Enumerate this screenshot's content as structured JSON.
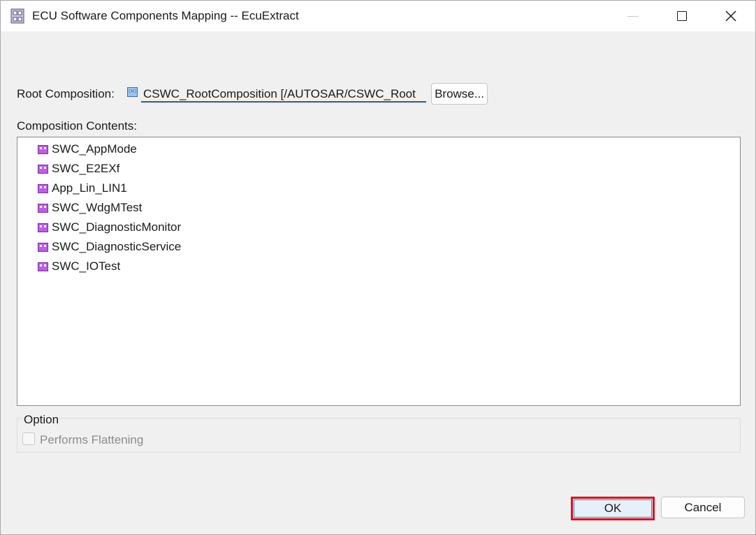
{
  "window": {
    "title": "ECU Software Components Mapping -- EcuExtract"
  },
  "root_composition": {
    "label": "Root Composition:",
    "value": "CSWC_RootComposition [/AUTOSAR/CSWC_Root",
    "browse_label": "Browse..."
  },
  "composition_contents": {
    "label": "Composition Contents:",
    "items": [
      {
        "label": "SWC_AppMode",
        "icon": "software-component-icon"
      },
      {
        "label": "SWC_E2EXf",
        "icon": "software-component-icon"
      },
      {
        "label": "App_Lin_LIN1",
        "icon": "software-component-icon"
      },
      {
        "label": "SWC_WdgMTest",
        "icon": "software-component-icon"
      },
      {
        "label": "SWC_DiagnosticMonitor",
        "icon": "software-component-icon"
      },
      {
        "label": "SWC_DiagnosticService",
        "icon": "software-component-icon"
      },
      {
        "label": "SWC_IOTest",
        "icon": "software-component-icon"
      }
    ]
  },
  "option": {
    "legend": "Option",
    "flattening_label": "Performs Flattening",
    "flattening_checked": false,
    "flattening_enabled": false
  },
  "buttons": {
    "ok_label": "OK",
    "cancel_label": "Cancel"
  },
  "colors": {
    "accent": "#1f5fa8",
    "highlight_border": "#d8101c",
    "component_icon": "#b44ee0"
  }
}
